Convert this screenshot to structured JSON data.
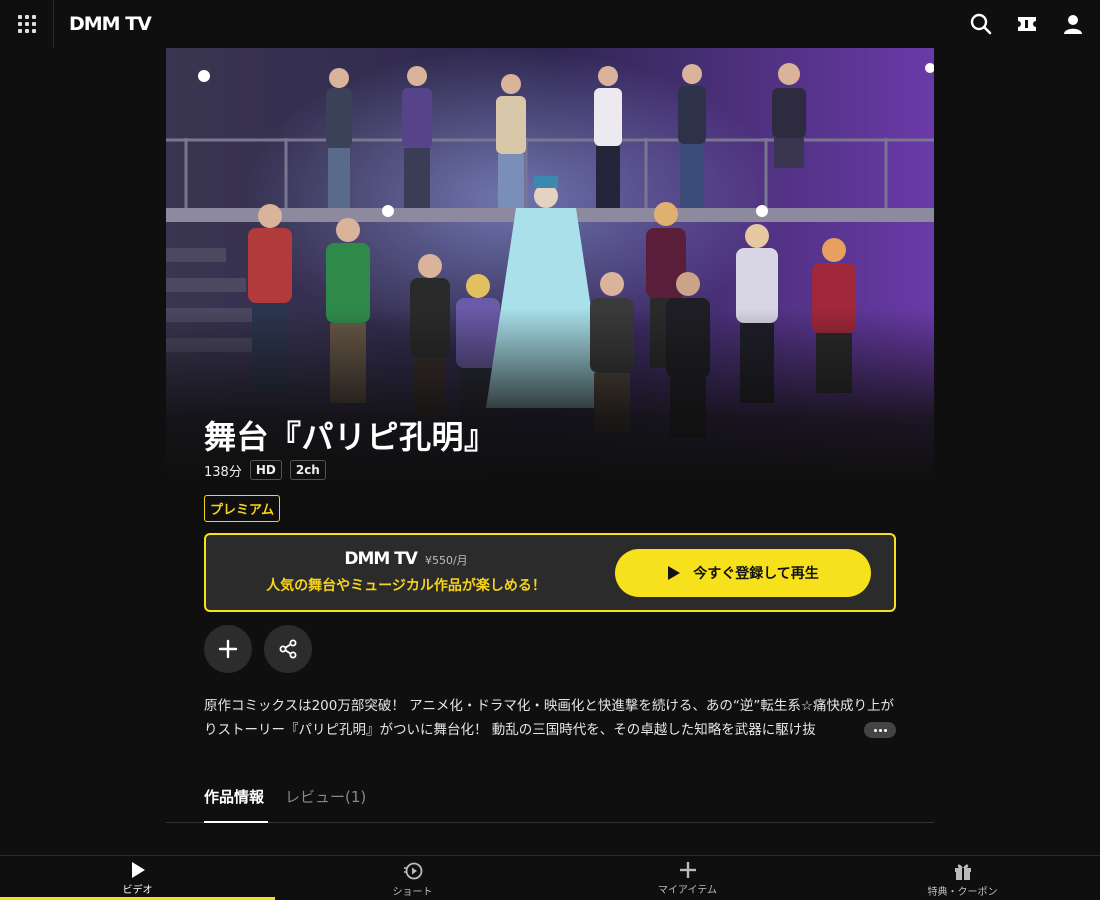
{
  "header": {
    "logo": "DMM TV",
    "icons": [
      "grid-menu-icon",
      "search-icon",
      "ticket-icon",
      "user-icon"
    ]
  },
  "work": {
    "title": "舞台『パリピ孔明』",
    "duration": "138分",
    "badges": [
      "HD",
      "2ch"
    ],
    "plan_label": "プレミアム"
  },
  "promo": {
    "logo": "DMM TV",
    "price": "¥550/月",
    "text": "人気の舞台やミュージカル作品が楽しめる！",
    "button_label": "今すぐ登録して再生"
  },
  "actions": {
    "add_icon": "plus-icon",
    "share_icon": "share-icon"
  },
  "description": "原作コミックスは200万部突破！ アニメ化・ドラマ化・映画化と快進撃を続ける、あの“逆”転生系☆痛快成り上がりストーリー『パリピ孔明』がついに舞台化！ 動乱の三国時代を、その卓越した知略を武器に駆け抜",
  "tabs": [
    {
      "label": "作品情報",
      "active": true
    },
    {
      "label": "レビュー(1)",
      "active": false
    }
  ],
  "bottom_nav": [
    {
      "label": "ビデオ",
      "icon": "play-icon",
      "active": true
    },
    {
      "label": "ショート",
      "icon": "short-video-icon",
      "active": false
    },
    {
      "label": "マイアイテム",
      "icon": "plus-icon",
      "active": false
    },
    {
      "label": "特典・クーポン",
      "icon": "gift-icon",
      "active": false
    }
  ],
  "colors": {
    "background": "#0f0f0f",
    "accent": "#f7e11c",
    "promo_text": "#f7d31c"
  }
}
